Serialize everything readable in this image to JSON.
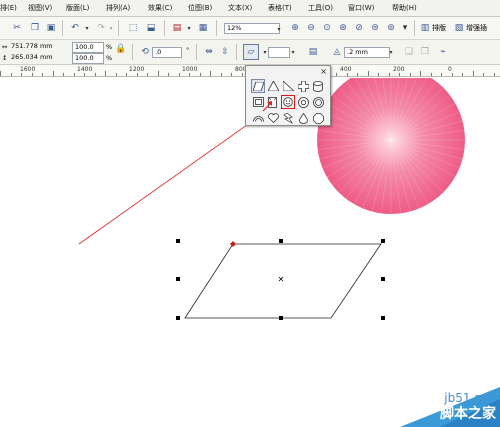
{
  "menu": {
    "items": [
      "排(E)",
      "视图(V)",
      "版面(L)",
      "排列(A)",
      "效果(C)",
      "位图(B)",
      "文本(X)",
      "表格(T)",
      "工具(O)",
      "窗口(W)",
      "帮助(H)"
    ]
  },
  "toolbar": {
    "zoom": "12%",
    "arrange_label": "排版",
    "enhance_label": "增强插"
  },
  "properties": {
    "x": "751.778 mm",
    "y": "265.034 mm",
    "scale_x": "100.0",
    "scale_y": "100.0",
    "scale_unit": "%",
    "rotation": ".0",
    "rotation_unit": "°",
    "outline_width": ".2 mm"
  },
  "ruler": {
    "labels": [
      "1600",
      "1400",
      "1200",
      "1000",
      "800",
      "400",
      "200",
      "0"
    ]
  },
  "popup": {
    "close": "×"
  },
  "watermark": {
    "site": "jb51.net",
    "brand": "脚本之家"
  },
  "colors": {
    "circle": "#f0668c",
    "arrow": "#e02020",
    "selected_outline": "#e01818"
  }
}
